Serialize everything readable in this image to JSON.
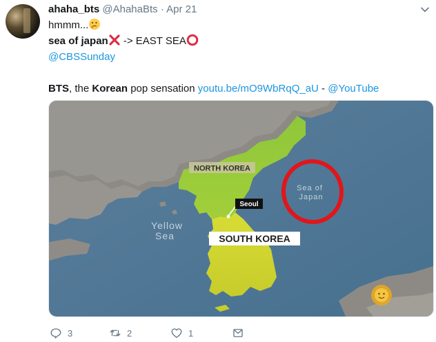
{
  "tweet": {
    "display_name": "ahaha_bts",
    "handle": "@AhahaBts",
    "separator": "·",
    "date": "Apr 21",
    "line1": "hmmm...",
    "line2_bold": "sea of japan",
    "line2_rest": " -> EAST SEA",
    "mention": "@CBSSunday",
    "line4_bold1": "BTS",
    "line4_mid": ", the ",
    "line4_bold2": "Korean",
    "line4_rest": " pop sensation ",
    "line4_link": "youtu.be/mO9WbRqQ_aU",
    "line4_dash": " - ",
    "line4_mention": "@YouTube"
  },
  "map": {
    "north_korea": "NORTH KOREA",
    "south_korea": "SOUTH KOREA",
    "seoul": "Seoul",
    "yellow_sea_1": "Yellow",
    "yellow_sea_2": "Sea",
    "sea_of_japan_1": "Sea of",
    "sea_of_japan_2": "Japan"
  },
  "actions": {
    "reply_count": "3",
    "retweet_count": "2",
    "like_count": "1"
  },
  "icons": [
    "thinking-face-icon",
    "cross-mark-icon",
    "red-circle-icon",
    "chevron-down-icon",
    "reply-icon",
    "retweet-icon",
    "like-icon",
    "direct-message-icon",
    "sun-logo-icon"
  ],
  "colors": {
    "link": "#1b95e0",
    "muted": "#657786",
    "annotation_red": "#e0161b"
  }
}
